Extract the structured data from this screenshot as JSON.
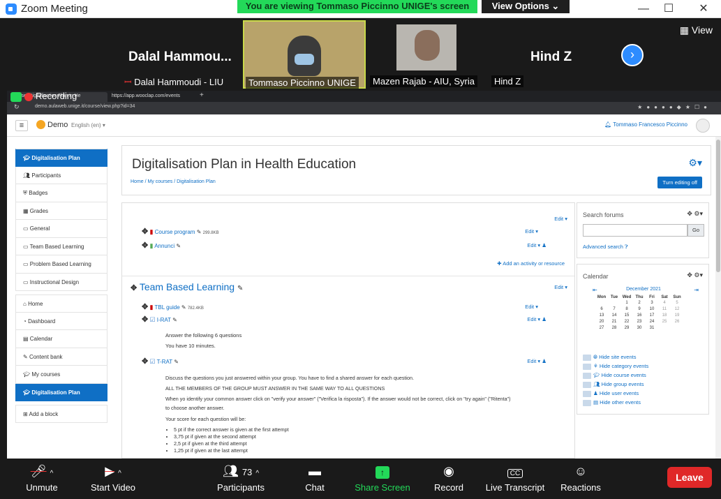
{
  "window": {
    "app_title": "Zoom Meeting",
    "viewing_banner": "You are viewing Tommaso Piccinno UNIGE's screen",
    "view_options": "View Options ⌄"
  },
  "strip": {
    "tile1_name": "Dalal  Hammou...",
    "tile1_label": "Dalal Hammoudi - LIU",
    "tile2_label": "Tommaso Piccinno UNIGE",
    "tile3_label": "Mazen Rajab - AIU, Syria",
    "tile4_name": "Hind Z",
    "tile4_label": "Hind Z",
    "view_label": "View"
  },
  "browser": {
    "tab1": "rse: Digitalisation Plan in He",
    "tab2": "https://app.wooclap.com/events",
    "recording_label": "Recording",
    "url": "demo.aulaweb.unige.it/course/view.php?id=34"
  },
  "moodle_nav": {
    "site_name": "Demo",
    "language": "English (en) ▾",
    "user": "Tommaso Francesco Piccinno"
  },
  "drawer": {
    "items": [
      {
        "label": "Digitalisation Plan",
        "icon": "graduation-cap-icon"
      },
      {
        "label": "Participants",
        "icon": "users-icon"
      },
      {
        "label": "Badges",
        "icon": "shield-icon"
      },
      {
        "label": "Grades",
        "icon": "table-icon"
      },
      {
        "label": "General",
        "icon": "folder-icon"
      },
      {
        "label": "Team Based Learning",
        "icon": "folder-icon"
      },
      {
        "label": "Problem Based Learning",
        "icon": "folder-icon"
      },
      {
        "label": "Instructional Design",
        "icon": "folder-icon"
      }
    ],
    "items2": [
      {
        "label": "Home",
        "icon": "home-icon"
      },
      {
        "label": "Dashboard",
        "icon": "dashboard-icon"
      },
      {
        "label": "Calendar",
        "icon": "calendar-icon"
      },
      {
        "label": "Content bank",
        "icon": "pencil-icon"
      },
      {
        "label": "My courses",
        "icon": "graduation-cap-icon"
      },
      {
        "label": "Digitalisation Plan",
        "icon": "graduation-cap-icon"
      }
    ],
    "add_block": "Add a block"
  },
  "header": {
    "course_title": "Digitalisation Plan in Health Education",
    "breadcrumb": "Home / My courses / Digitalisation Plan",
    "turn_editing": "Turn editing off"
  },
  "content": {
    "edit_label": "Edit ▾",
    "course_program": "Course program",
    "course_program_size": "299.8KB",
    "annunci": "Annunci",
    "add_activity": "Add an activity or resource",
    "section_title": "Team Based Learning",
    "tbl_guide": "TBL guide",
    "tbl_guide_size": "782.4KB",
    "irat": "I-RAT",
    "irat_text1": "Answer the following 6 questions",
    "irat_text2": "You have 10 minutes.",
    "trat": "T-RAT",
    "trat_text1": "Discuss the questions you just answered within your group. You have to find a shared answer for each question.",
    "trat_text2": "ALL THE MEMBERS OF THE GROUP MUST ANSWER IN THE SAME WAY TO ALL QUESTIONS",
    "trat_text3": "When yo identify your common answer click on \"verify your answer\" (\"Verifica la risposta\"). If the answer would not be correct, click on \"try again\" (\"Ritenta\")",
    "trat_text4": "to choose another answer.",
    "trat_text5": "Your score for each question will be:",
    "bullets": [
      "5 pt if the correct answer is given at the first attempt",
      "3,75 pt if given at the second attempt",
      "2,5 pt if given at the third attempt",
      "1,25 pt if given at the last attempt"
    ]
  },
  "search_block": {
    "title": "Search forums",
    "go": "Go",
    "advanced": "Advanced search"
  },
  "calendar_block": {
    "title": "Calendar",
    "month": "December 2021",
    "days": [
      "Mon",
      "Tue",
      "Wed",
      "Thu",
      "Fri",
      "Sat",
      "Sun"
    ],
    "weeks": [
      [
        "",
        "",
        "1",
        "2",
        "3",
        "4",
        "5"
      ],
      [
        "6",
        "7",
        "8",
        "9",
        "10",
        "11",
        "12"
      ],
      [
        "13",
        "14",
        "15",
        "16",
        "17",
        "18",
        "19"
      ],
      [
        "20",
        "21",
        "22",
        "23",
        "24",
        "25",
        "26"
      ],
      [
        "27",
        "28",
        "29",
        "30",
        "31",
        "",
        ""
      ]
    ],
    "legend": [
      "Hide site events",
      "Hide category events",
      "Hide course events",
      "Hide group events",
      "Hide user events",
      "Hide other events"
    ]
  },
  "toolbar": {
    "unmute": "Unmute",
    "start_video": "Start Video",
    "participants": "Participants",
    "participants_count": "73",
    "chat": "Chat",
    "share_screen": "Share Screen",
    "record": "Record",
    "live_transcript": "Live Transcript",
    "reactions": "Reactions",
    "leave": "Leave"
  },
  "colors": {
    "accent": "#0f6fc5",
    "zoom_blue": "#2d8cff",
    "share_green": "#23d959",
    "leave_red": "#e02828"
  }
}
